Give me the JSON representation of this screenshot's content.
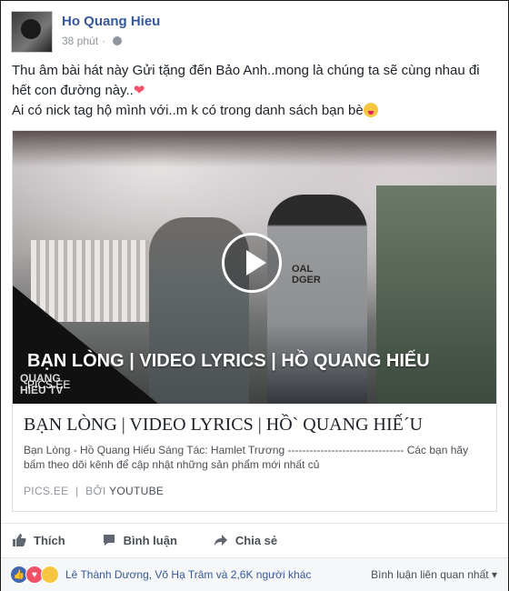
{
  "post": {
    "author": "Ho Quang Hieu",
    "time": "38 phút",
    "dot": "·",
    "text_line1": "Thu âm bài hát này Gửi tặng đến Bảo Anh..mong là chúng ta sẽ cùng nhau đi hết con đường này..",
    "text_line2": "Ai có nick tag hộ mình với..m k có trong danh sách bạn bè"
  },
  "media": {
    "overlay_title": "BẠN LÒNG | VIDEO LYRICS | HỒ QUANG HIẾU",
    "overlay_source": "PICS.EE",
    "hoodie_text": "OAL\nDGER",
    "logo_text": "QUANG\nHIEU TV"
  },
  "card": {
    "title": "BẠN LÒNG | VIDEO LYRICS | HỒ` QUANG HIẾ´U",
    "description": "Bạn Lòng - Hồ Quang Hiếu Sáng Tác: Hamlet Trương -------------------------------- Các bạn hãy bấm theo dõi kênh để cập nhật những sản phẩm mới nhất củ",
    "domain": "PICS.EE",
    "separator": "|",
    "by_label": "BỞI",
    "by_value": "YOUTUBE"
  },
  "actions": {
    "like": "Thích",
    "comment": "Bình luận",
    "share": "Chia sẻ"
  },
  "footer": {
    "reactors": "Lê Thành Dương, Võ Hạ Trâm và 2,6K người khác",
    "sort": "Bình luận liên quan nhất",
    "sort_caret": "▾"
  },
  "colors": {
    "link_blue": "#365899",
    "like_blue": "#4267b2",
    "heart_red": "#f25268",
    "haha_yellow": "#f7c641"
  }
}
